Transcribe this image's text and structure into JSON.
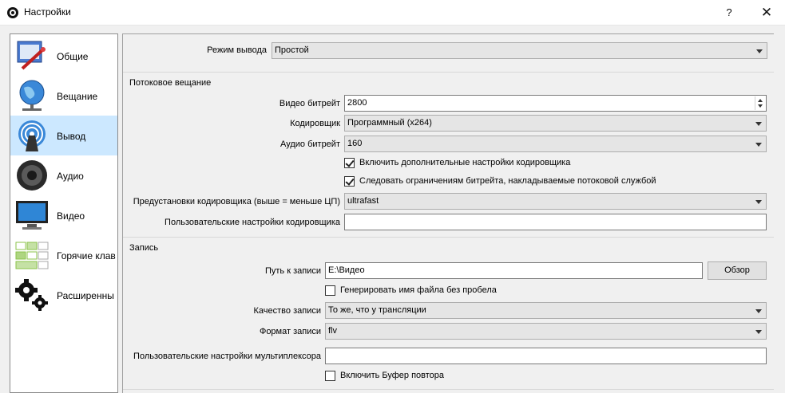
{
  "window": {
    "title": "Настройки",
    "help_label": "?",
    "close_label": "✕"
  },
  "sidebar": {
    "items": [
      {
        "label": "Общие",
        "icon": "general-settings-icon"
      },
      {
        "label": "Вещание",
        "icon": "broadcast-globe-icon"
      },
      {
        "label": "Вывод",
        "icon": "output-signal-icon",
        "selected": true
      },
      {
        "label": "Аудио",
        "icon": "speaker-icon"
      },
      {
        "label": "Видео",
        "icon": "monitor-icon"
      },
      {
        "label": "Горячие клав",
        "icon": "keyboard-icon"
      },
      {
        "label": "Расширенны",
        "icon": "gears-icon"
      }
    ]
  },
  "output": {
    "mode_label": "Режим вывода",
    "mode_value": "Простой"
  },
  "streaming": {
    "group_title": "Потоковое вещание",
    "video_bitrate_label": "Видео битрейт",
    "video_bitrate_value": "2800",
    "encoder_label": "Кодировщик",
    "encoder_value": "Программный (x264)",
    "audio_bitrate_label": "Аудио битрейт",
    "audio_bitrate_value": "160",
    "advanced_encoder_label": "Включить дополнительные настройки кодировщика",
    "advanced_encoder_checked": true,
    "enforce_limits_label": "Следовать ограничениям битрейта, накладываемые потоковой службой",
    "enforce_limits_checked": true,
    "preset_label": "Предустановки кодировщика (выше = меньше ЦП)",
    "preset_value": "ultrafast",
    "custom_settings_label": "Пользовательские настройки кодировщика",
    "custom_settings_value": ""
  },
  "recording": {
    "group_title": "Запись",
    "path_label": "Путь к записи",
    "path_value": "E:\\Видео",
    "browse_label": "Обзор",
    "no_space_label": "Генерировать имя файла без пробела",
    "no_space_checked": false,
    "quality_label": "Качество записи",
    "quality_value": "То же, что у трансляции",
    "format_label": "Формат записи",
    "format_value": "flv",
    "muxer_label": "Пользовательские настройки мультиплексора",
    "muxer_value": "",
    "replay_buffer_label": "Включить Буфер повтора",
    "replay_buffer_checked": false
  },
  "colors": {
    "selected_nav": "#cce8ff",
    "window_bg": "#f0f0f0"
  }
}
